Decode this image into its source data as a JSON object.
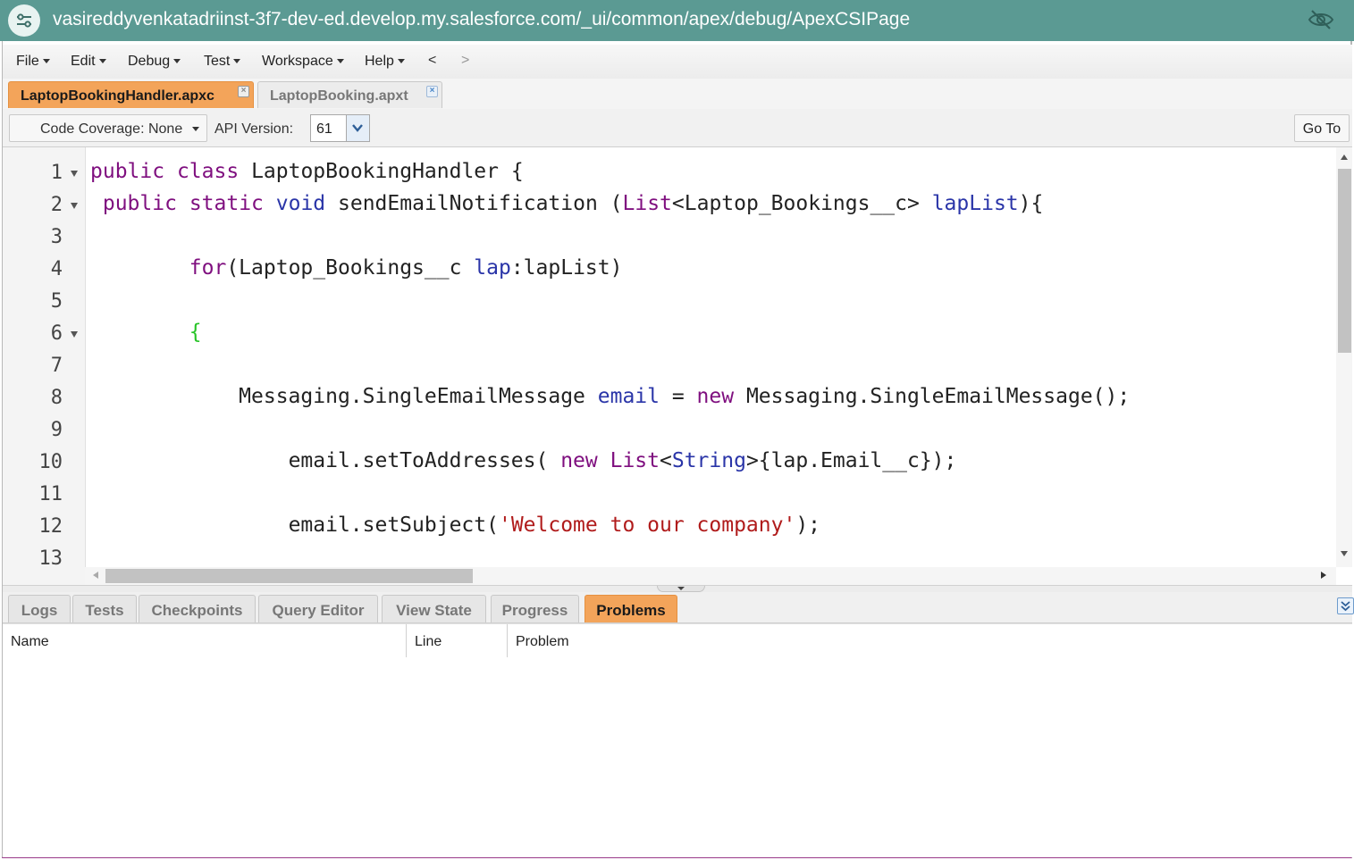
{
  "browser": {
    "url": "vasireddyvenkatadriinst-3f7-dev-ed.develop.my.salesforce.com/_ui/common/apex/debug/ApexCSIPage"
  },
  "menu": {
    "items": [
      {
        "label": "File"
      },
      {
        "label": "Edit"
      },
      {
        "label": "Debug"
      },
      {
        "label": "Test"
      },
      {
        "label": "Workspace"
      },
      {
        "label": "Help"
      }
    ],
    "back": "<",
    "forward": ">"
  },
  "file_tabs": [
    {
      "label": "LaptopBookingHandler.apxc",
      "active": true
    },
    {
      "label": "LaptopBooking.apxt",
      "active": false
    }
  ],
  "toolbar": {
    "coverage_label": "Code Coverage: None",
    "api_label": "API Version:",
    "api_value": "61",
    "goto_label": "Go To"
  },
  "code_lines": [
    "1",
    "2",
    "3",
    "4",
    "5",
    "6",
    "7",
    "8",
    "9",
    "10",
    "11",
    "12",
    "13"
  ],
  "bottom_tabs": [
    {
      "label": "Logs"
    },
    {
      "label": "Tests"
    },
    {
      "label": "Checkpoints"
    },
    {
      "label": "Query Editor"
    },
    {
      "label": "View State"
    },
    {
      "label": "Progress"
    },
    {
      "label": "Problems",
      "active": true
    }
  ],
  "problems_table": {
    "columns": [
      "Name",
      "Line",
      "Problem"
    ],
    "rows": []
  },
  "colors": {
    "accent_tab": "#f3a45a",
    "url_bar": "#5b9a93"
  }
}
